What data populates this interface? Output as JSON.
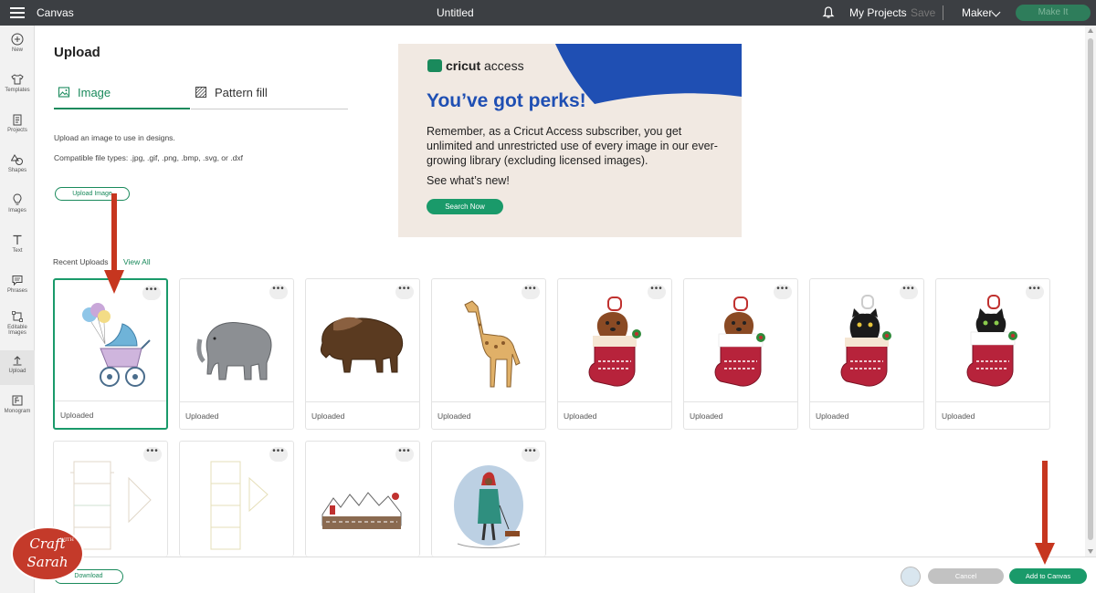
{
  "topbar": {
    "app_title": "Canvas",
    "doc_title": "Untitled",
    "my_projects": "My Projects",
    "save": "Save",
    "machine": "Maker",
    "make_it": "Make It"
  },
  "sidebar": {
    "items": [
      {
        "label": "New",
        "icon": "plus-circle-icon"
      },
      {
        "label": "Templates",
        "icon": "shirt-icon"
      },
      {
        "label": "Projects",
        "icon": "clipboard-icon"
      },
      {
        "label": "Shapes",
        "icon": "shapes-icon"
      },
      {
        "label": "Images",
        "icon": "lightbulb-icon"
      },
      {
        "label": "Text",
        "icon": "text-icon"
      },
      {
        "label": "Phrases",
        "icon": "speech-bubble-icon"
      },
      {
        "label": "Editable",
        "label2": "Images",
        "icon": "editable-images-icon"
      },
      {
        "label": "Upload",
        "icon": "upload-icon",
        "active": true
      },
      {
        "label": "Monogram",
        "icon": "monogram-icon"
      }
    ]
  },
  "upload_panel": {
    "title": "Upload",
    "tabs": [
      {
        "label": "Image",
        "icon": "image-icon",
        "active": true
      },
      {
        "label": "Pattern fill",
        "icon": "pattern-icon",
        "active": false
      }
    ],
    "description": "Upload an image to use in designs.",
    "file_types": "Compatible file types: .jpg, .gif, .png, .bmp, .svg, or .dxf",
    "upload_button": "Upload Image"
  },
  "promo": {
    "logo_brand": "cricut",
    "logo_product": "access",
    "headline": "You’ve got perks!",
    "body": "Remember, as a Cricut Access subscriber, you get unlimited and unrestricted use of every image in our ever-growing library (excluding licensed images).",
    "see_new": "See what’s new!",
    "button": "Search Now",
    "colors": {
      "background": "#f1e9e2",
      "blue": "#1f4fb3",
      "green": "#1a9a6a"
    }
  },
  "recent": {
    "label": "Recent Uploads",
    "view_all": "View All",
    "items": [
      {
        "caption": "Uploaded",
        "art": "baby-carriage-balloons",
        "selected": true
      },
      {
        "caption": "Uploaded",
        "art": "elephant"
      },
      {
        "caption": "Uploaded",
        "art": "bison"
      },
      {
        "caption": "Uploaded",
        "art": "giraffe"
      },
      {
        "caption": "Uploaded",
        "art": "puppy-stocking"
      },
      {
        "caption": "Uploaded",
        "art": "puppy-stocking-2"
      },
      {
        "caption": "Uploaded",
        "art": "black-kitten-stocking"
      },
      {
        "caption": "Uploaded",
        "art": "black-kitten-stocking-2"
      },
      {
        "caption": "",
        "art": "box-template"
      },
      {
        "caption": "",
        "art": "box-template-2"
      },
      {
        "caption": "",
        "art": "winter-village"
      },
      {
        "caption": "",
        "art": "woman-walking-dog"
      }
    ]
  },
  "bottombar": {
    "download": "Download",
    "cancel": "Cancel",
    "add_to_canvas": "Add to Canvas"
  },
  "watermark": {
    "line1": "Craft",
    "with": "WITH",
    "line2": "Sarah"
  }
}
